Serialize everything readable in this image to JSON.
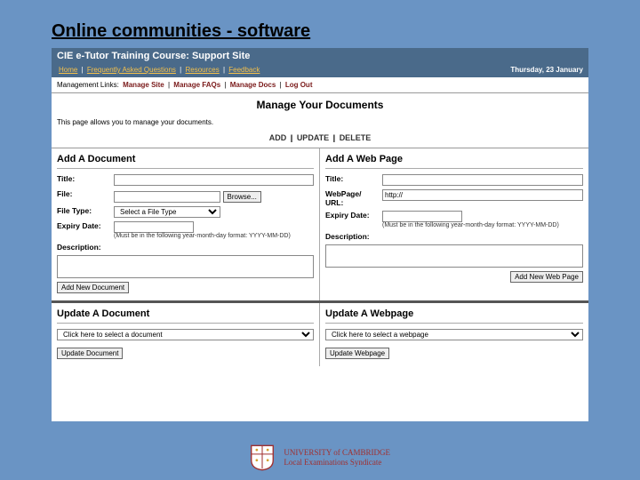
{
  "slide_title": "Online communities - software",
  "header": {
    "site_title": "CIE e-Tutor Training Course: Support Site",
    "nav_label": "",
    "links": [
      "Home",
      "Frequently Asked Questions",
      "Resources",
      "Feedback"
    ],
    "date": "Thursday, 23 January"
  },
  "mgmt": {
    "label": "Management Links:",
    "items": [
      "Manage Site",
      "Manage FAQs",
      "Manage Docs",
      "Log Out"
    ]
  },
  "page_title": "Manage Your Documents",
  "intro": "This page allows you to manage your documents.",
  "actions": [
    "ADD",
    "UPDATE",
    "DELETE"
  ],
  "add_doc": {
    "heading": "Add A Document",
    "title_label": "Title:",
    "file_label": "File:",
    "browse_label": "Browse...",
    "filetype_label": "File Type:",
    "filetype_placeholder": "Select a File Type",
    "expiry_label": "Expiry Date:",
    "expiry_hint": "(Must be in the following year-month-day format: YYYY-MM-DD)",
    "desc_label": "Description:",
    "submit": "Add New Document"
  },
  "add_web": {
    "heading": "Add A Web Page",
    "title_label": "Title:",
    "url_label": "WebPage/\nURL:",
    "url_value": "http://",
    "expiry_label": "Expiry Date:",
    "expiry_hint": "(Must be in the following year-month-day format: YYYY-MM-DD)",
    "desc_label": "Description:",
    "submit": "Add New Web Page"
  },
  "upd_doc": {
    "heading": "Update A Document",
    "select_placeholder": "Click here to select a document",
    "submit": "Update Document"
  },
  "upd_web": {
    "heading": "Update A Webpage",
    "select_placeholder": "Click here to select a webpage",
    "submit": "Update Webpage"
  },
  "footer": {
    "line1": "UNIVERSITY of CAMBRIDGE",
    "line2": "Local Examinations Syndicate"
  }
}
